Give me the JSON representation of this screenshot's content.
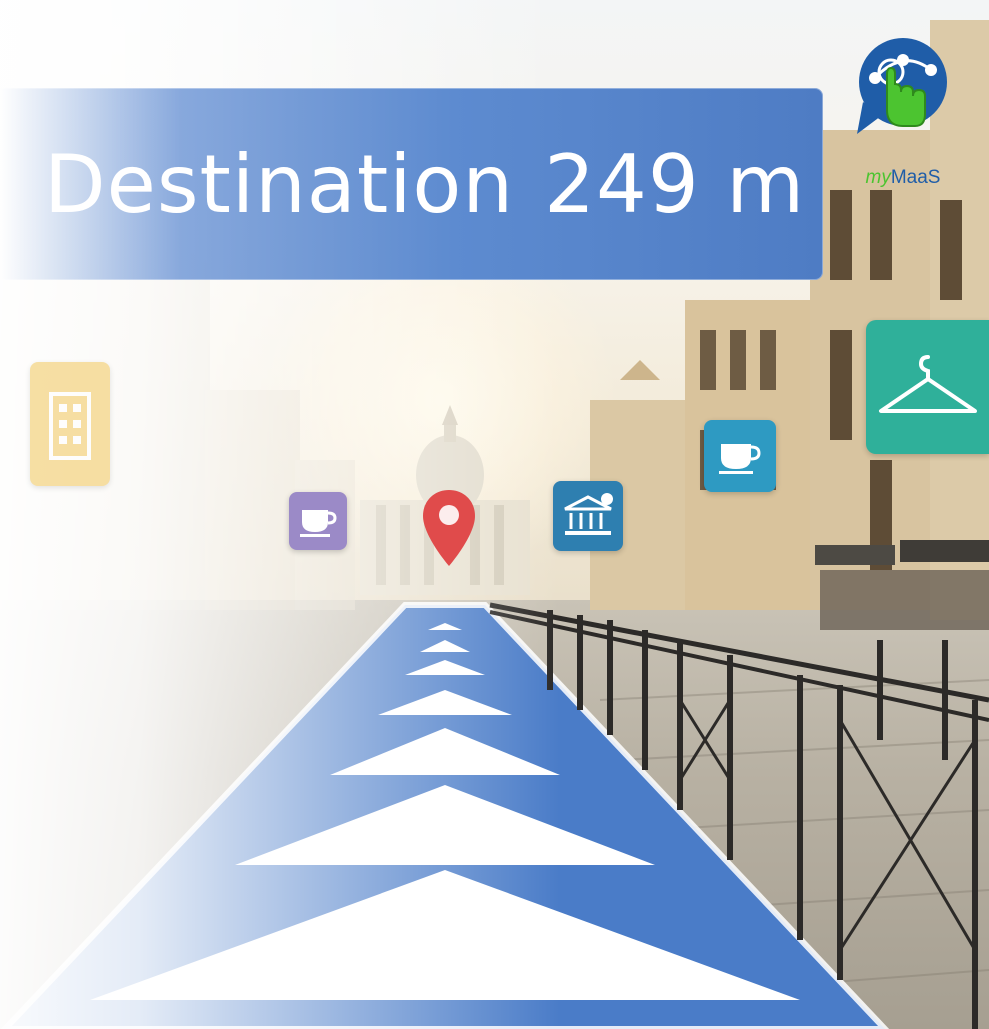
{
  "navigation": {
    "label": "Destination",
    "distance": "249 m"
  },
  "brand": {
    "logo_prefix": "my",
    "logo_suffix": "MaaS",
    "primary_color": "#1f5da8",
    "accent_color": "#4cc430"
  },
  "route_color": "#4a7cc8",
  "banner_color": "#5d8bd0",
  "poi_markers": [
    {
      "icon": "office-building-icon",
      "color": "#f2c75c"
    },
    {
      "icon": "coffee-cup-icon",
      "color": "#9b8ac7"
    },
    {
      "icon": "location-pin-icon",
      "color": "#e04b4b"
    },
    {
      "icon": "bank-icon",
      "color": "#2e7fb0"
    },
    {
      "icon": "coffee-cup-icon",
      "color": "#2e9ac2"
    },
    {
      "icon": "clothes-hanger-icon",
      "color": "#2fb09a"
    }
  ]
}
